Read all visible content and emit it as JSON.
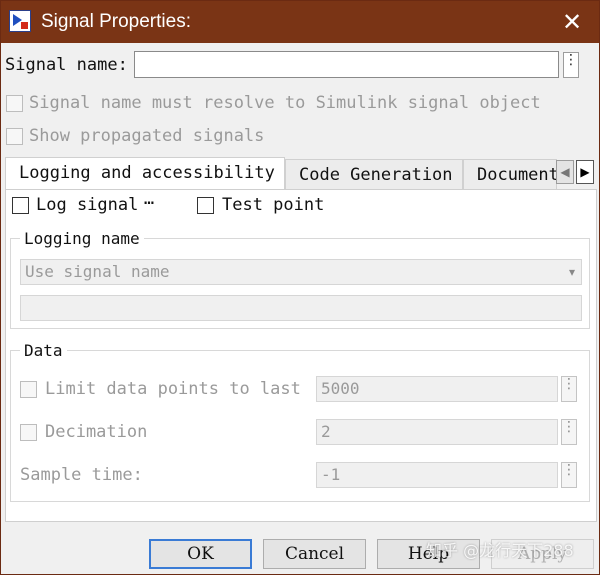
{
  "window": {
    "title": "Signal Properties:",
    "close_glyph": "✕"
  },
  "signal_name": {
    "label": "Signal name:",
    "value": "",
    "more_glyph": "⋮"
  },
  "options": {
    "resolve_label": "Signal name must resolve to Simulink signal object",
    "propagated_label": "Show propagated signals"
  },
  "tabs": [
    {
      "label": "Logging and accessibility",
      "active": true
    },
    {
      "label": "Code Generation",
      "active": false
    },
    {
      "label": "Documentation",
      "active": false
    }
  ],
  "tab_scroll": {
    "left": "◀",
    "right": "▶"
  },
  "logging": {
    "log_signal_label": "Log signal",
    "log_signal_more": "⋯",
    "test_point_label": "Test point",
    "group_title": "Logging name",
    "name_mode": "Use signal name",
    "name_mode_arrow": "▾",
    "name_value": ""
  },
  "data": {
    "group_title": "Data",
    "limit_label": "Limit data points to last",
    "limit_value": "5000",
    "decimation_label": "Decimation",
    "decimation_value": "2",
    "sample_time_label": "Sample time:",
    "sample_time_value": "-1",
    "more_glyph": "⋮"
  },
  "buttons": {
    "ok": "OK",
    "cancel": "Cancel",
    "help": "Help",
    "apply": "Apply"
  },
  "watermark": "知乎 @龙行天下288",
  "colors": {
    "titlebar": "#7a3415",
    "default_button_border": "#3a7bd5"
  }
}
